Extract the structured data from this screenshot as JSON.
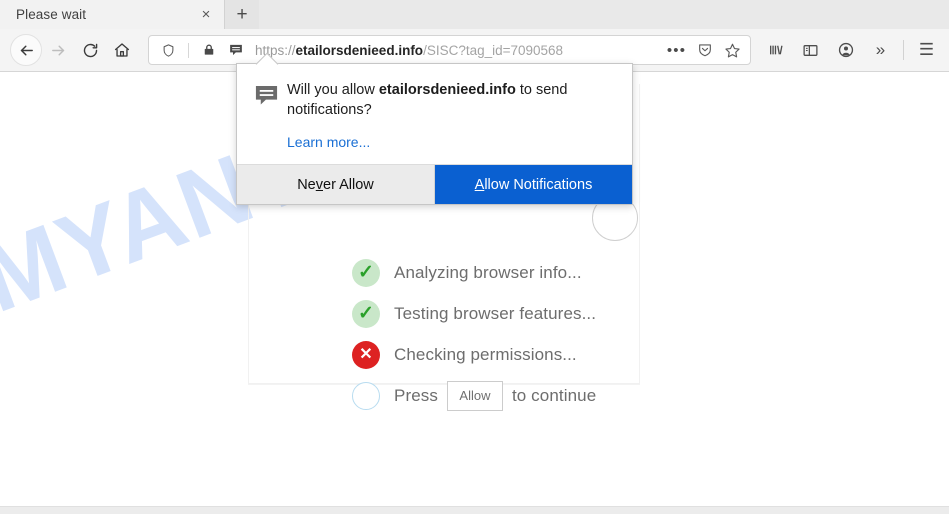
{
  "browser": {
    "tab": {
      "title": "Please wait",
      "close_label": "×",
      "newtab_label": "+"
    },
    "nav": {
      "back_name": "back-button",
      "forward_name": "forward-button",
      "reload_name": "reload-button",
      "home_name": "home-button"
    },
    "urlbar": {
      "scheme": "https://",
      "host": "etailorsdenieed.info",
      "path": "/SISC?tag_id=7090568",
      "full_url": "https://etailorsdenieed.info/SISC?tag_id=7090568",
      "icons": [
        "shield-icon",
        "padlock-icon",
        "notification-permission-icon"
      ],
      "page_actions_label": "•••",
      "save_to_pocket": "pocket-icon",
      "bookmark": "star-icon"
    },
    "toolbar_right": {
      "library": "library-icon",
      "sidebar": "sidebar-icon",
      "account": "account-icon",
      "overflow_label": "»",
      "menu_label": "☰"
    }
  },
  "permission_popup": {
    "question_prefix": "Will you allow ",
    "question_domain": "etailorsdenieed.info",
    "question_suffix": " to send notifications?",
    "learn_more": "Learn more...",
    "never_allow": {
      "pre": "Ne",
      "mnemonic": "v",
      "post": "er Allow"
    },
    "allow_notifications": {
      "mnemonic": "A",
      "post": "llow Notifications"
    }
  },
  "page": {
    "watermark": "MYANTISPYWARE.COM",
    "watermark_color": "#d5e3fb",
    "checklist": [
      {
        "state": "ok",
        "glyph": "✓",
        "label": "Analyzing browser info..."
      },
      {
        "state": "ok",
        "glyph": "✓",
        "label": "Testing browser features..."
      },
      {
        "state": "bad",
        "glyph": "✕",
        "label": "Checking permissions..."
      },
      {
        "state": "pending",
        "glyph": "",
        "label_before": "Press",
        "button_label": "Allow",
        "label_after": "to continue"
      }
    ]
  },
  "colors": {
    "accent_blue": "#0a60d1",
    "link_blue": "#1a6fd4",
    "success_green": "#2aa02a",
    "error_red": "#dd2222"
  }
}
